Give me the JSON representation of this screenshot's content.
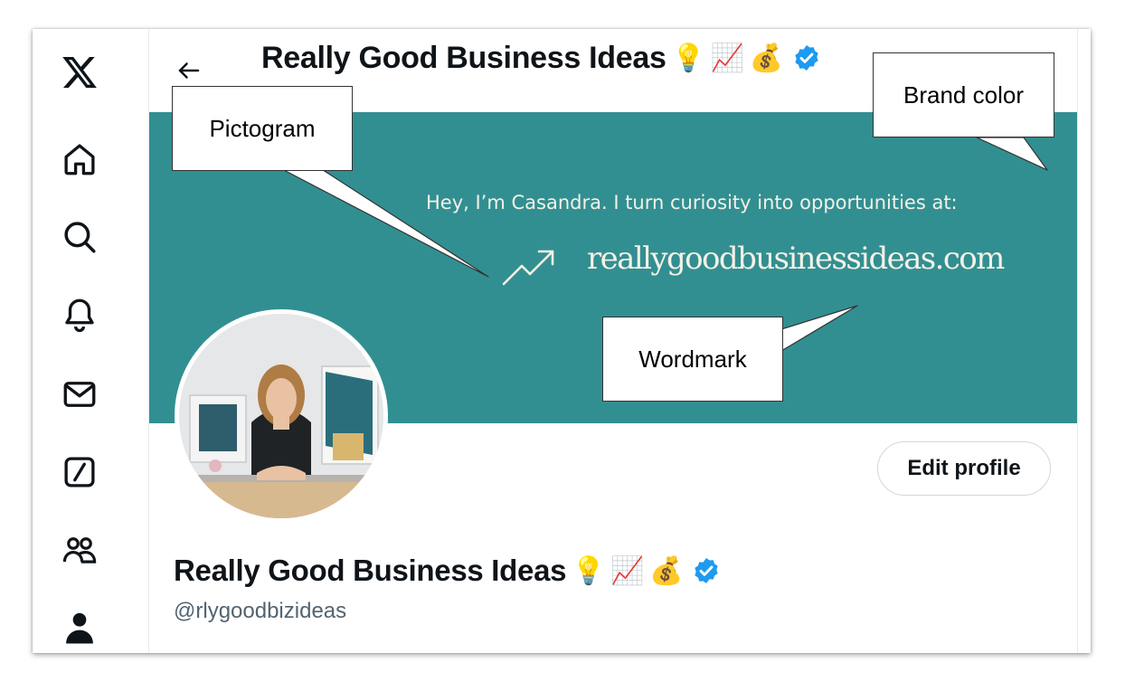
{
  "header": {
    "back_icon": "arrow-left-icon",
    "title": "Really Good Business Ideas",
    "emojis": [
      "💡",
      "📈",
      "💰"
    ],
    "verified_icon": "verified-badge-icon"
  },
  "sidebar": {
    "items": [
      {
        "name": "x-logo",
        "icon": "x-logo-icon"
      },
      {
        "name": "home",
        "icon": "home-icon"
      },
      {
        "name": "explore",
        "icon": "search-icon"
      },
      {
        "name": "notifications",
        "icon": "bell-icon"
      },
      {
        "name": "messages",
        "icon": "envelope-icon"
      },
      {
        "name": "grok",
        "icon": "slash-square-icon"
      },
      {
        "name": "communities",
        "icon": "people-icon"
      },
      {
        "name": "profile",
        "icon": "person-icon"
      }
    ]
  },
  "banner": {
    "tagline": "Hey, I’m Casandra. I turn curiosity into opportunities at:",
    "wordmark": "reallygoodbusinessideas.com",
    "pictogram_icon": "trend-arrow-icon",
    "background_color": "#328f91"
  },
  "profile": {
    "edit_button": "Edit profile",
    "name": "Really Good Business Ideas",
    "emojis": [
      "💡",
      "📈",
      "💰"
    ],
    "handle": "@rlygoodbizideas"
  },
  "callouts": {
    "pictogram": "Pictogram",
    "brand_color": "Brand color",
    "wordmark": "Wordmark"
  },
  "colors": {
    "brand_teal": "#328f91",
    "verified_blue": "#1d9bf0",
    "text_primary": "#0f1419",
    "text_secondary": "#536471"
  }
}
